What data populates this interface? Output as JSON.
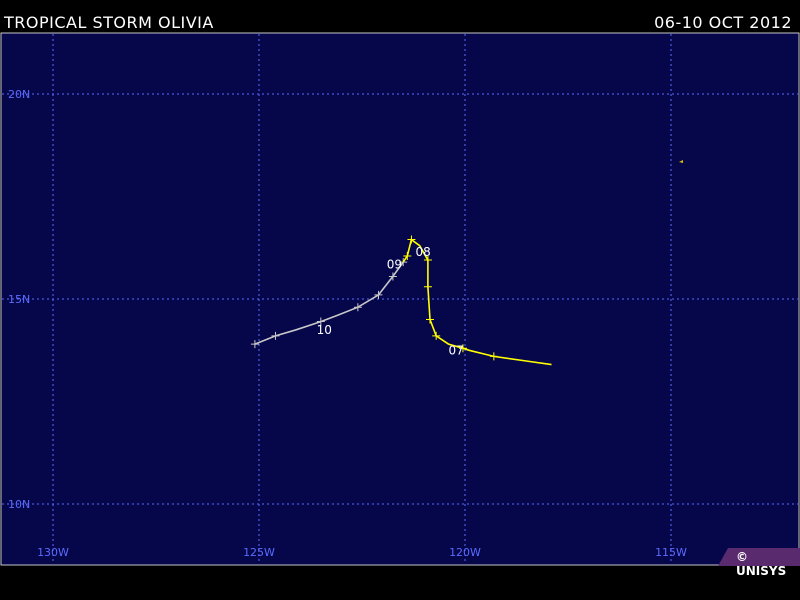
{
  "header": {
    "title": "TROPICAL STORM OLIVIA",
    "dates": "06-10 OCT 2012"
  },
  "colors": {
    "ocean": "#06064a",
    "grid": "#5a6cff",
    "track_storm": "#ffff00",
    "track_forecast": "#c8c8c8",
    "label": "#ffffff",
    "logo_bg": "#5a2a6e"
  },
  "map": {
    "lon_range": [
      -131,
      -113
    ],
    "lat_range": [
      9,
      21.5
    ],
    "lon_ticks": [
      {
        "value": -130,
        "label": "130W"
      },
      {
        "value": -125,
        "label": "125W"
      },
      {
        "value": -120,
        "label": "120W"
      },
      {
        "value": -115,
        "label": "115W"
      }
    ],
    "lat_ticks": [
      {
        "value": 20,
        "label": "20N"
      },
      {
        "value": 15,
        "label": "15N"
      },
      {
        "value": 10,
        "label": "10N"
      }
    ]
  },
  "tracks": {
    "storm": {
      "points": [
        [
          -117.9,
          13.4
        ],
        [
          -118.6,
          13.5
        ],
        [
          -119.3,
          13.6
        ],
        [
          -119.9,
          13.75
        ],
        [
          -120.05,
          13.8
        ],
        [
          -120.4,
          13.9
        ],
        [
          -120.7,
          14.1
        ],
        [
          -120.85,
          14.5
        ],
        [
          -120.9,
          15.3
        ],
        [
          -120.9,
          15.95
        ],
        [
          -121.1,
          16.3
        ],
        [
          -121.3,
          16.45
        ],
        [
          -121.4,
          16.05
        ],
        [
          -121.5,
          15.9
        ]
      ],
      "marker_indices": [
        2,
        4,
        6,
        7,
        8,
        9,
        11,
        12
      ]
    },
    "forecast": {
      "points": [
        [
          -121.5,
          15.9
        ],
        [
          -121.75,
          15.55
        ],
        [
          -122.1,
          15.1
        ],
        [
          -122.6,
          14.8
        ],
        [
          -123.1,
          14.6
        ],
        [
          -123.5,
          14.45
        ],
        [
          -124.1,
          14.25
        ],
        [
          -124.6,
          14.1
        ],
        [
          -125.1,
          13.9
        ]
      ],
      "marker_indices": [
        0,
        1,
        2,
        3,
        5,
        7,
        8
      ]
    }
  },
  "day_labels": [
    {
      "text": "07",
      "lon": -120.4,
      "lat": 13.65
    },
    {
      "text": "08",
      "lon": -121.2,
      "lat": 16.05
    },
    {
      "text": "09",
      "lon": -121.9,
      "lat": 15.75
    },
    {
      "text": "10",
      "lon": -123.6,
      "lat": 14.15
    }
  ],
  "logo": {
    "text": "© UNISYS"
  }
}
